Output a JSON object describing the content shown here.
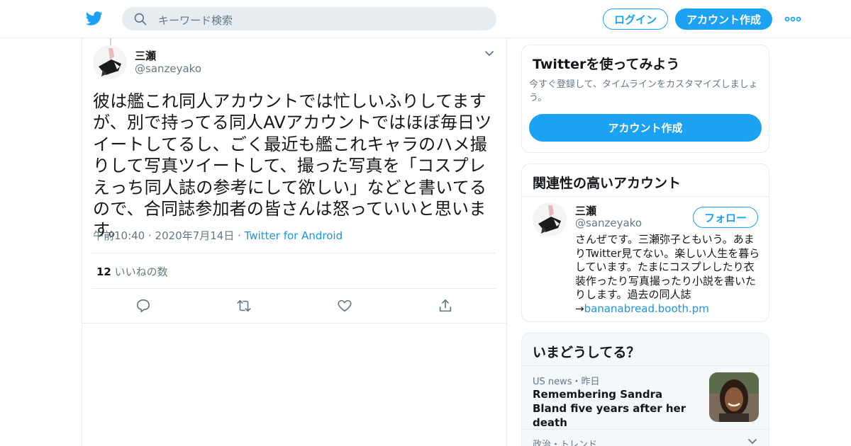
{
  "header": {
    "search_placeholder": "キーワード検索",
    "login_label": "ログイン",
    "signup_label": "アカウント作成",
    "brand_color": "#1da1f2"
  },
  "tweet": {
    "author_name": "三瀬",
    "author_handle": "@sanzeyako",
    "text": "彼は艦これ同人アカウントでは忙しいふりしてますが、別で持ってる同人AVアカウントではほぼ毎日ツイートしてるし、ごく最近も艦これキャラのハメ撮りして写真ツイートして、撮った写真を「コスプレえっち同人誌の参考にして欲しい」などと書いてるので、合同誌参加者の皆さんは怒っていいと思います。",
    "time": "午前10:40",
    "date": "2020年7月14日",
    "source": "Twitter for Android",
    "likes_count": "12",
    "likes_label": "いいねの数",
    "actions": [
      "reply-icon",
      "retweet-icon",
      "like-icon",
      "share-icon"
    ]
  },
  "signup_card": {
    "title": "Twitterを使ってみよう",
    "description": "今すぐ登録して、タイムラインをカスタマイズしましょう。",
    "button_label": "アカウント作成"
  },
  "related_card": {
    "title": "関連性の高いアカウント",
    "account_name": "三瀬",
    "account_handle": "@sanzeyako",
    "follow_label": "フォロー",
    "bio": "さんぜです。三瀬弥子ともいう。あまりTwitter見てない。楽しい人生を暮らしています。たまにコスプレしたり衣装作ったり写真撮ったり小説を書いたりします。過去の同人誌→",
    "bio_link": "bananabread.booth.pm"
  },
  "trends_card": {
    "title": "いまどうしてる？",
    "items": [
      {
        "context": "US news・昨日",
        "headline": "Remembering Sandra Bland five years after her death"
      },
      {
        "context": "政治・トレンド"
      }
    ]
  }
}
